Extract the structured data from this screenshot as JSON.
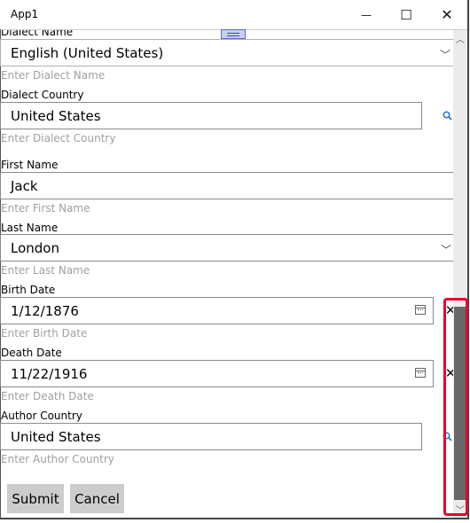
{
  "window": {
    "title": "App1",
    "minimize_glyph": "—",
    "maximize_glyph": "☐",
    "close_glyph": "✕"
  },
  "form": {
    "dialect_name": {
      "label": "Dialect Name",
      "value": "English (United States)",
      "hint": "Enter Dialect Name"
    },
    "dialect_country": {
      "label": "Dialect Country",
      "value": "United States",
      "hint": "Enter Dialect Country"
    },
    "first_name": {
      "label": "First Name",
      "value": "Jack",
      "hint": "Enter First Name"
    },
    "last_name": {
      "label": "Last Name",
      "value": "London",
      "hint": "Enter Last Name"
    },
    "birth_date": {
      "label": "Birth Date",
      "value": "1/12/1876",
      "hint": "Enter Birth Date"
    },
    "death_date": {
      "label": "Death Date",
      "value": "11/22/1916",
      "hint": "Enter Death Date"
    },
    "author_country": {
      "label": "Author Country",
      "value": "United States",
      "hint": "Enter Author Country"
    }
  },
  "buttons": {
    "submit": "Submit",
    "cancel": "Cancel"
  },
  "icons": {
    "search": "search-icon",
    "calendar": "calendar-icon",
    "clear": "close-icon",
    "chevron": "chevron-down-icon"
  },
  "colors": {
    "highlight": "#e8002b",
    "scroll_thumb": "#686868",
    "button_bg": "#cccccc",
    "search_icon": "#1e6fd9"
  }
}
